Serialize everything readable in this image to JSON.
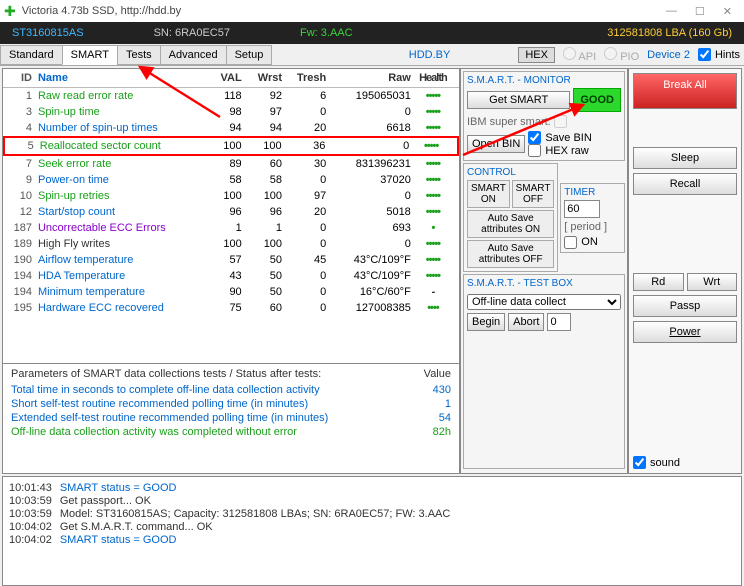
{
  "window": {
    "title": "Victoria 4.73b SSD, http://hdd.by"
  },
  "header": {
    "model": "ST3160815AS",
    "sn": "SN: 6RA0EC57",
    "fw": "Fw: 3.AAC",
    "lba": "312581808 LBA (160 Gb)"
  },
  "tabs": [
    "Standard",
    "SMART",
    "Tests",
    "Advanced",
    "Setup"
  ],
  "active_tab": 1,
  "hddby": "HDD.BY",
  "hex": "HEX",
  "api": "API",
  "pio": "PIO",
  "device": "Device 2",
  "hints": "Hints",
  "smart": {
    "columns": {
      "id": "ID",
      "name": "Name",
      "val": "VAL",
      "wrst": "Wrst",
      "tresh": "Tresh",
      "raw": "Raw",
      "health": "Health"
    },
    "rows": [
      {
        "id": "1",
        "name": "Raw read error rate",
        "val": "118",
        "wrst": "92",
        "tr": "6",
        "raw": "195065031",
        "h": "•••••",
        "c": "#1a9f1a"
      },
      {
        "id": "3",
        "name": "Spin-up time",
        "val": "98",
        "wrst": "97",
        "tr": "0",
        "raw": "0",
        "h": "•••••",
        "c": "#1a9f1a"
      },
      {
        "id": "4",
        "name": "Number of spin-up times",
        "val": "94",
        "wrst": "94",
        "tr": "20",
        "raw": "6618",
        "h": "•••••",
        "c": "#0066cc"
      },
      {
        "id": "5",
        "name": "Reallocated sector count",
        "val": "100",
        "wrst": "100",
        "tr": "36",
        "raw": "0",
        "h": "•••••",
        "c": "#1a9f1a",
        "hl": true
      },
      {
        "id": "7",
        "name": "Seek error rate",
        "val": "89",
        "wrst": "60",
        "tr": "30",
        "raw": "831396231",
        "h": "•••••",
        "c": "#1a9f1a"
      },
      {
        "id": "9",
        "name": "Power-on time",
        "val": "58",
        "wrst": "58",
        "tr": "0",
        "raw": "37020",
        "h": "•••••",
        "c": "#0066cc"
      },
      {
        "id": "10",
        "name": "Spin-up retries",
        "val": "100",
        "wrst": "100",
        "tr": "97",
        "raw": "0",
        "h": "•••••",
        "c": "#1a9f1a"
      },
      {
        "id": "12",
        "name": "Start/stop count",
        "val": "96",
        "wrst": "96",
        "tr": "20",
        "raw": "5018",
        "h": "•••••",
        "c": "#0066cc"
      },
      {
        "id": "187",
        "name": "Uncorrectable ECC Errors",
        "val": "1",
        "wrst": "1",
        "tr": "0",
        "raw": "693",
        "h": "•",
        "c": "#8800cc"
      },
      {
        "id": "189",
        "name": "High Fly writes",
        "val": "100",
        "wrst": "100",
        "tr": "0",
        "raw": "0",
        "h": "•••••",
        "c": "#333"
      },
      {
        "id": "190",
        "name": "Airflow temperature",
        "val": "57",
        "wrst": "50",
        "tr": "45",
        "raw": "43°C/109°F",
        "h": "•••••",
        "c": "#0066cc"
      },
      {
        "id": "194",
        "name": "HDA Temperature",
        "val": "43",
        "wrst": "50",
        "tr": "0",
        "raw": "43°C/109°F",
        "h": "•••••",
        "c": "#0066cc"
      },
      {
        "id": "194",
        "name": "Minimum temperature",
        "val": "90",
        "wrst": "50",
        "tr": "0",
        "raw": "16°C/60°F",
        "h": "-",
        "c": "#0066cc",
        "hc": "#333"
      },
      {
        "id": "195",
        "name": "Hardware ECC recovered",
        "val": "75",
        "wrst": "60",
        "tr": "0",
        "raw": "127008385",
        "h": "••••",
        "c": "#0066cc"
      }
    ]
  },
  "params": {
    "header_label": "Parameters of SMART data collections tests / Status after tests:",
    "value_label": "Value",
    "rows": [
      {
        "label": "Total time in seconds to complete off-line data collection activity",
        "value": "430",
        "g": false
      },
      {
        "label": "Short self-test routine recommended polling time (in minutes)",
        "value": "1",
        "g": false
      },
      {
        "label": "Extended self-test routine recommended polling time (in minutes)",
        "value": "54",
        "g": false
      },
      {
        "label": "Off-line data collection activity was completed without error",
        "value": "82h",
        "g": true
      }
    ]
  },
  "monitor": {
    "title": "S.M.A.R.T. - MONITOR",
    "get_smart": "Get SMART",
    "good": "GOOD",
    "ibm": "IBM super smart:",
    "open_bin": "Open BIN",
    "save_bin": "Save BIN",
    "hex_raw": "HEX raw",
    "control": "CONTROL",
    "smart_on": "SMART ON",
    "smart_off": "SMART OFF",
    "autosave_on": "Auto Save attributes ON",
    "autosave_off": "Auto Save attributes OFF",
    "timer": "TIMER",
    "timer_val": "60",
    "period": "[ period ]",
    "on": "ON",
    "testbox": "S.M.A.R.T. - TEST BOX",
    "dropdown": "Off-line data collect",
    "begin": "Begin",
    "abort": "Abort",
    "test_val": "0"
  },
  "side": {
    "break": "Break All",
    "sleep": "Sleep",
    "recall": "Recall",
    "rd": "Rd",
    "wrt": "Wrt",
    "passp": "Passp",
    "power": "Power",
    "sound": "sound"
  },
  "log": [
    {
      "t": "10:01:43",
      "m": "SMART status = GOOD",
      "blue": true
    },
    {
      "t": "10:03:59",
      "m": "Get passport... OK"
    },
    {
      "t": "10:03:59",
      "m": "Model: ST3160815AS; Capacity: 312581808 LBAs; SN: 6RA0EC57; FW: 3.AAC"
    },
    {
      "t": "10:04:02",
      "m": "Get S.M.A.R.T. command... OK"
    },
    {
      "t": "10:04:02",
      "m": "SMART status = GOOD",
      "blue": true
    }
  ]
}
